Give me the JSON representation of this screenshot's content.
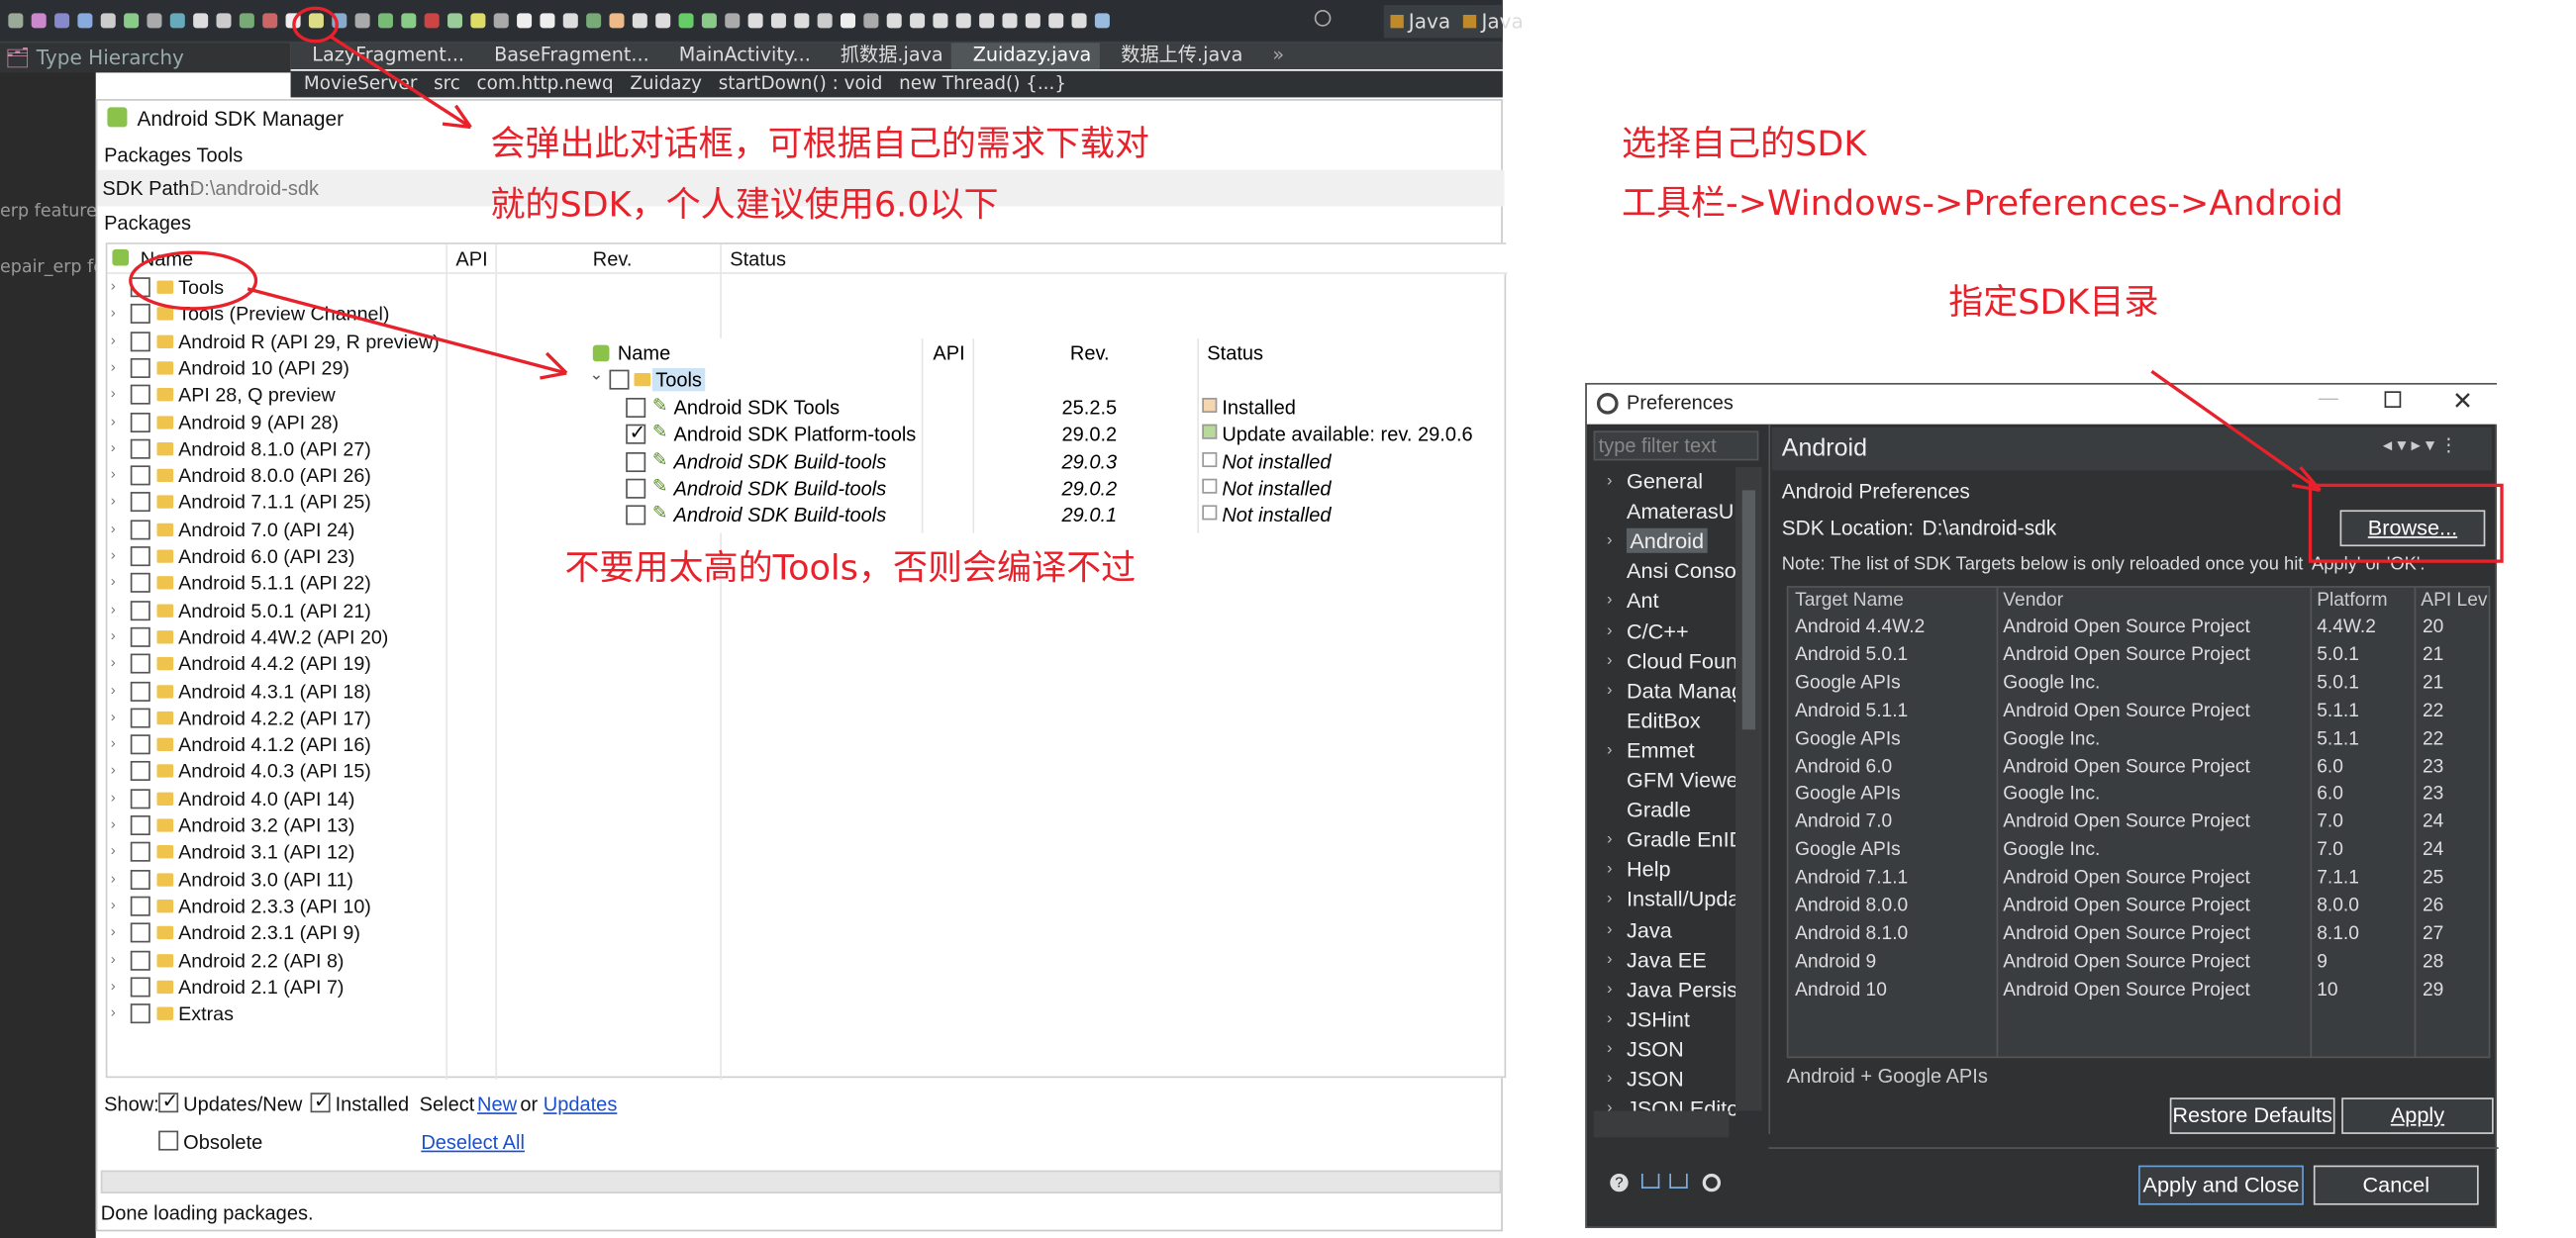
{
  "ide": {
    "left_panel_title": "Type Hierarchy",
    "tabs": [
      "LazyFragment...",
      "BaseFragment...",
      "MainActivity...",
      "抓数据.java",
      "Zuidazy.java",
      "数据上传.java"
    ],
    "tab_overflow": "»",
    "perspectives": [
      "Java",
      "Java"
    ],
    "breadcrumb": [
      "MovieServer",
      "src",
      "com.http.newq",
      "Zuidazy",
      "startDown() : void",
      "new Thread() {...}"
    ],
    "project_labels": [
      "erp feature_",
      "epair_erp fe"
    ]
  },
  "sdk_manager": {
    "title": "Android SDK Manager",
    "menu": [
      "Packages",
      "Tools"
    ],
    "sdk_path_label": "SDK Path:",
    "sdk_path_value": "D:\\android-sdk",
    "packages_header": "Packages",
    "columns": [
      "Name",
      "API",
      "Rev.",
      "Status"
    ],
    "rows": [
      {
        "name": "Tools",
        "folder": true
      },
      {
        "name": "Tools (Preview Channel)",
        "folder": true
      },
      {
        "name": "Android R (API 29, R preview)",
        "folder": true
      },
      {
        "name": "Android 10 (API 29)",
        "folder": true
      },
      {
        "name": "API 28, Q preview",
        "folder": true
      },
      {
        "name": "Android 9 (API 28)",
        "folder": true
      },
      {
        "name": "Android 8.1.0 (API 27)",
        "folder": true
      },
      {
        "name": "Android 8.0.0 (API 26)",
        "folder": true
      },
      {
        "name": "Android 7.1.1 (API 25)",
        "folder": true
      },
      {
        "name": "Android 7.0 (API 24)",
        "folder": true
      },
      {
        "name": "Android 6.0 (API 23)",
        "folder": true
      },
      {
        "name": "Android 5.1.1 (API 22)",
        "folder": true
      },
      {
        "name": "Android 5.0.1 (API 21)",
        "folder": true
      },
      {
        "name": "Android 4.4W.2 (API 20)",
        "folder": true
      },
      {
        "name": "Android 4.4.2 (API 19)",
        "folder": true
      },
      {
        "name": "Android 4.3.1 (API 18)",
        "folder": true
      },
      {
        "name": "Android 4.2.2 (API 17)",
        "folder": true
      },
      {
        "name": "Android 4.1.2 (API 16)",
        "folder": true
      },
      {
        "name": "Android 4.0.3 (API 15)",
        "folder": true
      },
      {
        "name": "Android 4.0 (API 14)",
        "folder": true
      },
      {
        "name": "Android 3.2 (API 13)",
        "folder": true
      },
      {
        "name": "Android 3.1 (API 12)",
        "folder": true
      },
      {
        "name": "Android 3.0 (API 11)",
        "folder": true
      },
      {
        "name": "Android 2.3.3 (API 10)",
        "folder": true
      },
      {
        "name": "Android 2.3.1 (API 9)",
        "folder": true
      },
      {
        "name": "Android 2.2 (API 8)",
        "folder": true
      },
      {
        "name": "Android 2.1 (API 7)",
        "folder": true
      },
      {
        "name": "Extras",
        "folder": true
      }
    ],
    "show_label": "Show:",
    "updates_new_label": "Updates/New",
    "installed_label": "Installed",
    "select_label": "Select",
    "new_link": "New",
    "or_label": "or",
    "updates_link": "Updates",
    "obsolete_label": "Obsolete",
    "deselect_all": "Deselect All",
    "status_text": "Done loading packages."
  },
  "tools_detail": {
    "columns": [
      "Name",
      "API",
      "Rev.",
      "Status"
    ],
    "group": "Tools",
    "rows": [
      {
        "name": "Android SDK Tools",
        "rev": "25.2.5",
        "status": "Installed",
        "checked": false,
        "italic": false
      },
      {
        "name": "Android SDK Platform-tools",
        "rev": "29.0.2",
        "status": "Update available: rev. 29.0.6",
        "checked": true,
        "italic": false
      },
      {
        "name": "Android SDK Build-tools",
        "rev": "29.0.3",
        "status": "Not installed",
        "checked": false,
        "italic": true
      },
      {
        "name": "Android SDK Build-tools",
        "rev": "29.0.2",
        "status": "Not installed",
        "checked": false,
        "italic": true
      },
      {
        "name": "Android SDK Build-tools",
        "rev": "29.0.1",
        "status": "Not installed",
        "checked": false,
        "italic": true
      }
    ]
  },
  "annotations": {
    "popup_note_line1": "会弹出此对话框，可根据自己的需求下载对",
    "popup_note_line2": "就的SDK，个人建议使用6.0以下",
    "tools_note": "不要用太高的Tools，否则会编译不过",
    "choose_sdk": "选择自己的SDK",
    "path_note": "工具栏->Windows->Preferences->Android",
    "specify_dir": "指定SDK目录",
    "color": "#e8212b"
  },
  "preferences": {
    "title": "Preferences",
    "filter_placeholder": "type filter text",
    "nav": [
      {
        "label": "General",
        "arrow": true
      },
      {
        "label": "AmaterasUM",
        "arrow": false
      },
      {
        "label": "Android",
        "arrow": true,
        "selected": true
      },
      {
        "label": "Ansi Console",
        "arrow": false
      },
      {
        "label": "Ant",
        "arrow": true
      },
      {
        "label": "C/C++",
        "arrow": true
      },
      {
        "label": "Cloud Foundry",
        "arrow": true
      },
      {
        "label": "Data Management",
        "arrow": true
      },
      {
        "label": "EditBox",
        "arrow": false
      },
      {
        "label": "Emmet",
        "arrow": true
      },
      {
        "label": "GFM Viewer",
        "arrow": false
      },
      {
        "label": "Gradle",
        "arrow": false
      },
      {
        "label": "Gradle EnIDE",
        "arrow": true
      },
      {
        "label": "Help",
        "arrow": true
      },
      {
        "label": "Install/Update",
        "arrow": true
      },
      {
        "label": "Java",
        "arrow": true
      },
      {
        "label": "Java EE",
        "arrow": true
      },
      {
        "label": "Java Persistence",
        "arrow": true
      },
      {
        "label": "JSHint",
        "arrow": true
      },
      {
        "label": "JSON",
        "arrow": true
      },
      {
        "label": "JSON",
        "arrow": true
      },
      {
        "label": "JSON Editor",
        "arrow": true
      }
    ],
    "page_title": "Android",
    "section_title": "Android Preferences",
    "sdk_location_label": "SDK Location:",
    "sdk_location_value": "D:\\android-sdk",
    "browse": "Browse...",
    "note": "Note: The list of SDK Targets below is only reloaded once you hit 'Apply' or 'OK'.",
    "columns": [
      "Target Name",
      "Vendor",
      "Platform",
      "API Lev"
    ],
    "targets": [
      [
        "Android 4.4W.2",
        "Android Open Source Project",
        "4.4W.2",
        "20"
      ],
      [
        "Android 5.0.1",
        "Android Open Source Project",
        "5.0.1",
        "21"
      ],
      [
        "Google APIs",
        "Google Inc.",
        "5.0.1",
        "21"
      ],
      [
        "Android 5.1.1",
        "Android Open Source Project",
        "5.1.1",
        "22"
      ],
      [
        "Google APIs",
        "Google Inc.",
        "5.1.1",
        "22"
      ],
      [
        "Android 6.0",
        "Android Open Source Project",
        "6.0",
        "23"
      ],
      [
        "Google APIs",
        "Google Inc.",
        "6.0",
        "23"
      ],
      [
        "Android 7.0",
        "Android Open Source Project",
        "7.0",
        "24"
      ],
      [
        "Google APIs",
        "Google Inc.",
        "7.0",
        "24"
      ],
      [
        "Android 7.1.1",
        "Android Open Source Project",
        "7.1.1",
        "25"
      ],
      [
        "Android 8.0.0",
        "Android Open Source Project",
        "8.0.0",
        "26"
      ],
      [
        "Android 8.1.0",
        "Android Open Source Project",
        "8.1.0",
        "27"
      ],
      [
        "Android 9",
        "Android Open Source Project",
        "9",
        "28"
      ],
      [
        "Android 10",
        "Android Open Source Project",
        "10",
        "29"
      ]
    ],
    "selected_description": "Android + Google APIs",
    "restore_defaults": "Restore Defaults",
    "apply": "Apply",
    "apply_close": "Apply and Close",
    "cancel": "Cancel"
  }
}
